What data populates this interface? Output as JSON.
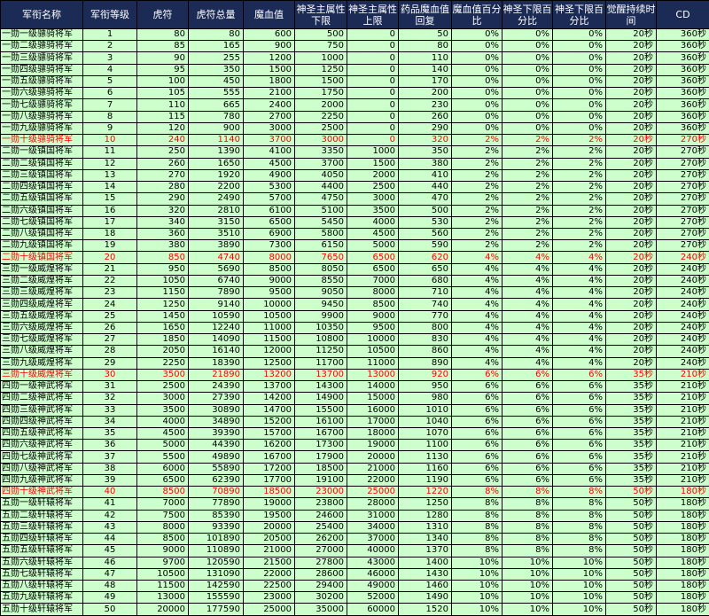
{
  "headers": [
    "军衔名称",
    "军衔等级",
    "虎符",
    "虎符总量",
    "魔血值",
    "神圣主属性下限",
    "神圣主属性上限",
    "药品魔血值回复",
    "魔血值百分比",
    "神圣下限百分比",
    "神圣下限百分比",
    "觉醒持续时间",
    "CD"
  ],
  "rows": [
    [
      "一勋一级骠骑将军",
      "1",
      "80",
      "80",
      "600",
      "500",
      "0",
      "50",
      "0%",
      "0%",
      "0%",
      "20秒",
      "360秒"
    ],
    [
      "一勋二级骠骑将军",
      "2",
      "85",
      "165",
      "900",
      "750",
      "0",
      "80",
      "0%",
      "0%",
      "0%",
      "20秒",
      "360秒"
    ],
    [
      "一勋三级骠骑将军",
      "3",
      "90",
      "255",
      "1200",
      "1000",
      "0",
      "110",
      "0%",
      "0%",
      "0%",
      "20秒",
      "360秒"
    ],
    [
      "一勋四级骠骑将军",
      "4",
      "95",
      "350",
      "1500",
      "1250",
      "0",
      "140",
      "0%",
      "0%",
      "0%",
      "20秒",
      "360秒"
    ],
    [
      "一勋五级骠骑将军",
      "5",
      "100",
      "450",
      "1800",
      "1500",
      "0",
      "170",
      "0%",
      "0%",
      "0%",
      "20秒",
      "360秒"
    ],
    [
      "一勋六级骠骑将军",
      "6",
      "105",
      "555",
      "2100",
      "1750",
      "0",
      "200",
      "0%",
      "0%",
      "0%",
      "20秒",
      "360秒"
    ],
    [
      "一勋七级骠骑将军",
      "7",
      "110",
      "665",
      "2400",
      "2000",
      "0",
      "230",
      "0%",
      "0%",
      "0%",
      "20秒",
      "360秒"
    ],
    [
      "一勋八级骠骑将军",
      "8",
      "115",
      "780",
      "2700",
      "2250",
      "0",
      "260",
      "0%",
      "0%",
      "0%",
      "20秒",
      "360秒"
    ],
    [
      "一勋九级骠骑将军",
      "9",
      "120",
      "900",
      "3000",
      "2500",
      "0",
      "290",
      "0%",
      "0%",
      "0%",
      "20秒",
      "360秒"
    ],
    [
      "一勋十级骠骑将军",
      "10",
      "240",
      "1140",
      "3700",
      "3000",
      "0",
      "320",
      "2%",
      "2%",
      "2%",
      "20秒",
      "270秒"
    ],
    [
      "二勋一级镇国将军",
      "11",
      "250",
      "1390",
      "4100",
      "3350",
      "1000",
      "350",
      "2%",
      "2%",
      "2%",
      "20秒",
      "270秒"
    ],
    [
      "二勋二级镇国将军",
      "12",
      "260",
      "1650",
      "4500",
      "3700",
      "1500",
      "380",
      "2%",
      "2%",
      "2%",
      "20秒",
      "270秒"
    ],
    [
      "二勋三级镇国将军",
      "13",
      "270",
      "1920",
      "4900",
      "4050",
      "2000",
      "410",
      "2%",
      "2%",
      "2%",
      "20秒",
      "270秒"
    ],
    [
      "二勋四级镇国将军",
      "14",
      "280",
      "2200",
      "5300",
      "4400",
      "2500",
      "440",
      "2%",
      "2%",
      "2%",
      "20秒",
      "270秒"
    ],
    [
      "二勋五级镇国将军",
      "15",
      "290",
      "2490",
      "5700",
      "4750",
      "3000",
      "470",
      "2%",
      "2%",
      "2%",
      "20秒",
      "270秒"
    ],
    [
      "二勋六级镇国将军",
      "16",
      "320",
      "2810",
      "6100",
      "5100",
      "3500",
      "500",
      "2%",
      "2%",
      "2%",
      "20秒",
      "270秒"
    ],
    [
      "二勋七级镇国将军",
      "17",
      "340",
      "3150",
      "6500",
      "5450",
      "4000",
      "530",
      "2%",
      "2%",
      "2%",
      "20秒",
      "270秒"
    ],
    [
      "二勋八级镇国将军",
      "18",
      "360",
      "3510",
      "6900",
      "5800",
      "4500",
      "560",
      "2%",
      "2%",
      "2%",
      "20秒",
      "270秒"
    ],
    [
      "二勋九级镇国将军",
      "19",
      "380",
      "3890",
      "7300",
      "6150",
      "5000",
      "590",
      "2%",
      "2%",
      "2%",
      "20秒",
      "270秒"
    ],
    [
      "二勋十级镇国将军",
      "20",
      "850",
      "4740",
      "8000",
      "7650",
      "6500",
      "620",
      "4%",
      "4%",
      "4%",
      "20秒",
      "240秒"
    ],
    [
      "三勋一级威煌将军",
      "21",
      "950",
      "5690",
      "8500",
      "8050",
      "6500",
      "650",
      "4%",
      "4%",
      "4%",
      "20秒",
      "240秒"
    ],
    [
      "三勋二级威煌将军",
      "22",
      "1050",
      "6740",
      "9000",
      "8550",
      "7000",
      "680",
      "4%",
      "4%",
      "4%",
      "20秒",
      "240秒"
    ],
    [
      "三勋三级威煌将军",
      "23",
      "1150",
      "7890",
      "9500",
      "9050",
      "8000",
      "710",
      "4%",
      "4%",
      "4%",
      "20秒",
      "240秒"
    ],
    [
      "三勋四级威煌将军",
      "24",
      "1250",
      "9140",
      "10000",
      "9450",
      "8500",
      "740",
      "4%",
      "4%",
      "4%",
      "20秒",
      "240秒"
    ],
    [
      "三勋五级威煌将军",
      "25",
      "1450",
      "10590",
      "10500",
      "9900",
      "9000",
      "770",
      "4%",
      "4%",
      "4%",
      "20秒",
      "240秒"
    ],
    [
      "三勋六级威煌将军",
      "26",
      "1650",
      "12240",
      "11000",
      "10350",
      "9500",
      "800",
      "4%",
      "4%",
      "4%",
      "20秒",
      "240秒"
    ],
    [
      "三勋七级威煌将军",
      "27",
      "1850",
      "14090",
      "11500",
      "10800",
      "10000",
      "830",
      "4%",
      "4%",
      "4%",
      "20秒",
      "240秒"
    ],
    [
      "三勋八级威煌将军",
      "28",
      "2050",
      "16140",
      "12000",
      "11250",
      "10500",
      "860",
      "4%",
      "4%",
      "4%",
      "20秒",
      "240秒"
    ],
    [
      "三勋九级威煌将军",
      "29",
      "2250",
      "18390",
      "12500",
      "11700",
      "11000",
      "890",
      "4%",
      "4%",
      "4%",
      "20秒",
      "240秒"
    ],
    [
      "三勋十级威煌将军",
      "30",
      "3500",
      "21890",
      "13200",
      "13700",
      "13000",
      "920",
      "6%",
      "6%",
      "6%",
      "35秒",
      "210秒"
    ],
    [
      "四勋一级神武将军",
      "31",
      "2500",
      "24390",
      "13700",
      "14300",
      "14000",
      "950",
      "6%",
      "6%",
      "6%",
      "35秒",
      "210秒"
    ],
    [
      "四勋二级神武将军",
      "32",
      "3000",
      "27390",
      "14200",
      "14900",
      "15000",
      "980",
      "6%",
      "6%",
      "6%",
      "35秒",
      "210秒"
    ],
    [
      "四勋三级神武将军",
      "33",
      "3500",
      "30890",
      "14700",
      "15500",
      "16000",
      "1010",
      "6%",
      "6%",
      "6%",
      "35秒",
      "210秒"
    ],
    [
      "四勋四级神武将军",
      "34",
      "4000",
      "34890",
      "15200",
      "16100",
      "17000",
      "1040",
      "6%",
      "6%",
      "6%",
      "35秒",
      "210秒"
    ],
    [
      "四勋五级神武将军",
      "35",
      "4500",
      "39390",
      "15700",
      "16700",
      "18000",
      "1070",
      "6%",
      "6%",
      "6%",
      "35秒",
      "210秒"
    ],
    [
      "四勋六级神武将军",
      "36",
      "5000",
      "44390",
      "16200",
      "17300",
      "19000",
      "1100",
      "6%",
      "6%",
      "6%",
      "35秒",
      "210秒"
    ],
    [
      "四勋七级神武将军",
      "37",
      "5500",
      "49890",
      "16700",
      "17900",
      "20000",
      "1130",
      "6%",
      "6%",
      "6%",
      "35秒",
      "210秒"
    ],
    [
      "四勋八级神武将军",
      "38",
      "6000",
      "55890",
      "17200",
      "18500",
      "21000",
      "1160",
      "6%",
      "6%",
      "6%",
      "35秒",
      "210秒"
    ],
    [
      "四勋九级神武将军",
      "39",
      "6500",
      "62390",
      "17700",
      "19100",
      "22000",
      "1190",
      "6%",
      "6%",
      "6%",
      "35秒",
      "210秒"
    ],
    [
      "四勋十级神武将军",
      "40",
      "8500",
      "70890",
      "18500",
      "23000",
      "25000",
      "1220",
      "8%",
      "8%",
      "8%",
      "50秒",
      "180秒"
    ],
    [
      "五勋一级轩辕将军",
      "41",
      "7000",
      "77890",
      "19000",
      "23800",
      "28000",
      "1250",
      "8%",
      "8%",
      "8%",
      "50秒",
      "180秒"
    ],
    [
      "五勋二级轩辕将军",
      "42",
      "7500",
      "85390",
      "19500",
      "24600",
      "31000",
      "1280",
      "8%",
      "8%",
      "8%",
      "50秒",
      "180秒"
    ],
    [
      "五勋三级轩辕将军",
      "43",
      "8000",
      "93390",
      "20000",
      "25400",
      "34000",
      "1310",
      "8%",
      "8%",
      "8%",
      "50秒",
      "180秒"
    ],
    [
      "五勋四级轩辕将军",
      "44",
      "8500",
      "101890",
      "20500",
      "26200",
      "37000",
      "1340",
      "8%",
      "8%",
      "8%",
      "50秒",
      "180秒"
    ],
    [
      "五勋五级轩辕将军",
      "45",
      "9000",
      "110890",
      "21000",
      "27000",
      "40000",
      "1370",
      "8%",
      "8%",
      "8%",
      "50秒",
      "180秒"
    ],
    [
      "五勋六级轩辕将军",
      "46",
      "9700",
      "120590",
      "21500",
      "27800",
      "43000",
      "1400",
      "10%",
      "10%",
      "10%",
      "50秒",
      "180秒"
    ],
    [
      "五勋七级轩辕将军",
      "47",
      "10500",
      "131090",
      "22000",
      "28600",
      "46000",
      "1430",
      "10%",
      "10%",
      "10%",
      "50秒",
      "180秒"
    ],
    [
      "五勋八级轩辕将军",
      "48",
      "11500",
      "142590",
      "22500",
      "29400",
      "49000",
      "1460",
      "10%",
      "10%",
      "10%",
      "50秒",
      "180秒"
    ],
    [
      "五勋九级轩辕将军",
      "49",
      "13000",
      "155590",
      "23000",
      "30200",
      "52000",
      "1490",
      "10%",
      "10%",
      "10%",
      "50秒",
      "180秒"
    ],
    [
      "五勋十级轩辕将军",
      "50",
      "20000",
      "177590",
      "25000",
      "35000",
      "60000",
      "1520",
      "10%",
      "10%",
      "10%",
      "50秒",
      "180秒"
    ]
  ],
  "highlight_rows": [
    9,
    19,
    29,
    39
  ],
  "colors": {
    "header_bg": "#1b2b56",
    "header_text": "#ffffff",
    "cell_bg": "#ccffcc",
    "highlight_text": "#ff0000",
    "border": "#000000"
  }
}
